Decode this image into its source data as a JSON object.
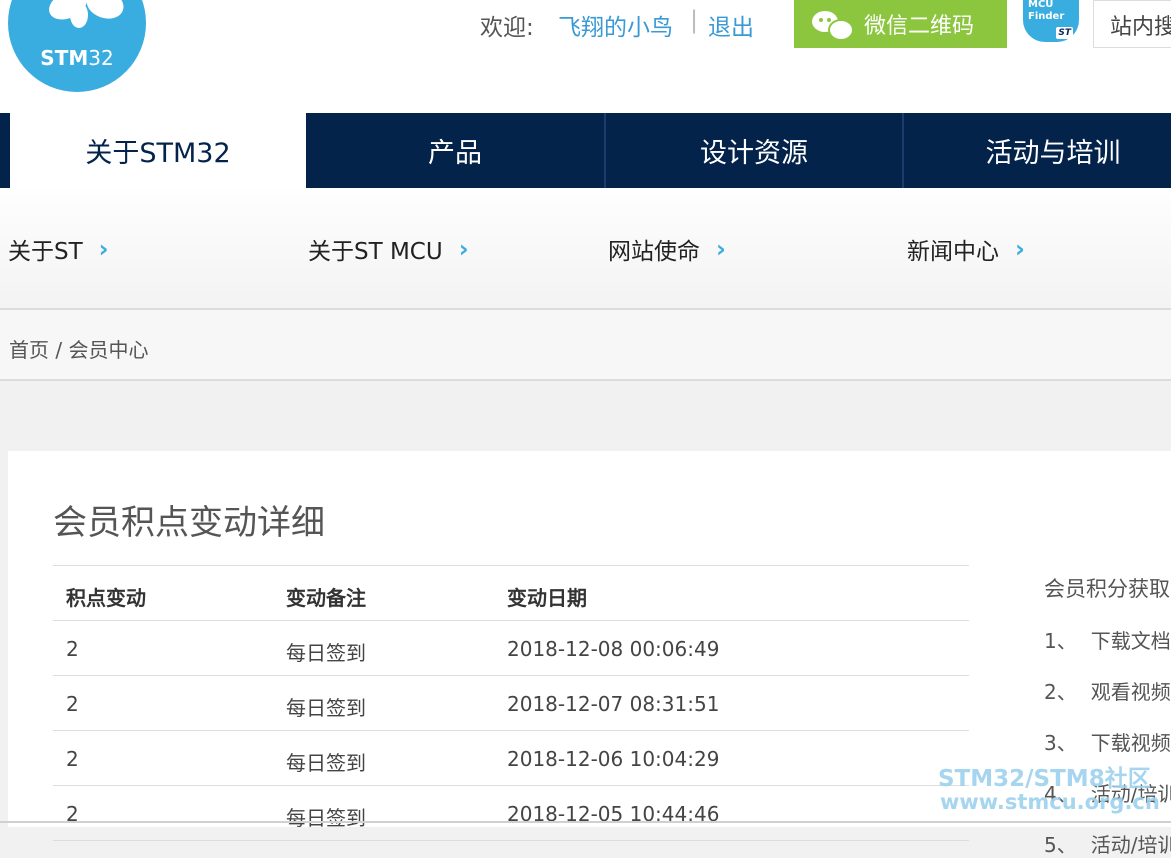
{
  "header": {
    "logo_text_bold": "STM",
    "logo_text_light": "32",
    "welcome_label": "欢迎:",
    "username": "飞翔的小鸟",
    "separator": "|",
    "logout": "退出",
    "wechat_qr": "微信二维码",
    "mcu_finder_line1": "MCU",
    "mcu_finder_line2": "Finder",
    "mcu_finder_brand": "ST",
    "site_search": "站内搜"
  },
  "main_nav": {
    "tabs": [
      {
        "label": "关于STM32",
        "active": true
      },
      {
        "label": "产品",
        "active": false
      },
      {
        "label": "设计资源",
        "active": false
      },
      {
        "label": "活动与培训",
        "active": false
      }
    ]
  },
  "sub_nav": {
    "items": [
      {
        "label": "关于ST",
        "chevron": "›"
      },
      {
        "label": "关于ST MCU",
        "chevron": "›"
      },
      {
        "label": "网站使命",
        "chevron": "›"
      },
      {
        "label": "新闻中心",
        "chevron": "›"
      }
    ]
  },
  "breadcrumb": {
    "home": "首页",
    "sep": "/",
    "current": "会员中心"
  },
  "content": {
    "title": "会员积点变动详细",
    "table": {
      "headers": [
        "积点变动",
        "变动备注",
        "变动日期"
      ],
      "rows": [
        [
          "2",
          "每日签到",
          "2018-12-08 00:06:49"
        ],
        [
          "2",
          "每日签到",
          "2018-12-07 08:31:51"
        ],
        [
          "2",
          "每日签到",
          "2018-12-06 10:04:29"
        ],
        [
          "2",
          "每日签到",
          "2018-12-05 10:44:46"
        ]
      ]
    },
    "sidebar": {
      "title": "会员积分获取",
      "items": [
        {
          "num": "1、",
          "text": "下载文档"
        },
        {
          "num": "2、",
          "text": "观看视频"
        },
        {
          "num": "3、",
          "text": "下载视频"
        },
        {
          "num": "4、",
          "text": "活动/培训"
        },
        {
          "num": "5、",
          "text": "活动/培训"
        }
      ]
    }
  },
  "watermark": {
    "line1": "STM32/STM8社区",
    "line2": "www.stmcu.org.cn"
  },
  "colors": {
    "nav_bg": "#03234b",
    "accent_blue": "#3aade0",
    "link_blue": "#3a9ad6",
    "wechat_green": "#8cc63f"
  }
}
